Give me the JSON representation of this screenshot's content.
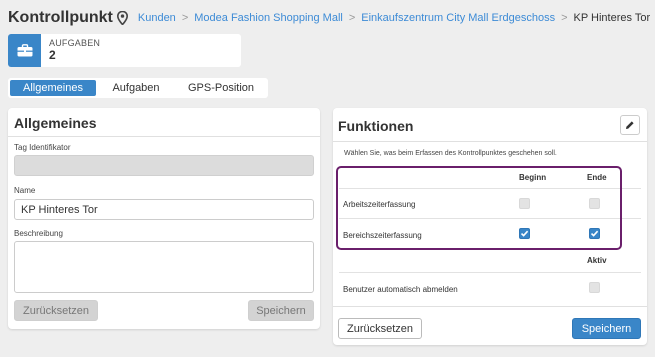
{
  "header": {
    "title": "Kontrollpunkt",
    "breadcrumb": [
      "Kunden",
      "Modea Fashion Shopping Mall",
      "Einkaufszentrum City Mall Erdgeschoss",
      "KP Hinteres Tor"
    ],
    "separator": ">"
  },
  "tasks": {
    "label": "AUFGABEN",
    "count": "2"
  },
  "tabs": [
    "Allgemeines",
    "Aufgaben",
    "GPS-Position"
  ],
  "general": {
    "title": "Allgemeines",
    "tag_label": "Tag Identifikator",
    "tag_value": "",
    "name_label": "Name",
    "name_value": "KP Hinteres Tor",
    "description_label": "Beschreibung",
    "description_value": "",
    "reset_label": "Zurücksetzen",
    "save_label": "Speichern"
  },
  "functions": {
    "title": "Funktionen",
    "description": "Wählen Sie, was beim Erfassen des Kontrollpunktes geschehen soll.",
    "col_begin": "Beginn",
    "col_end": "Ende",
    "col_active": "Aktiv",
    "rows": [
      {
        "label": "Arbeitszeiterfassung",
        "begin": false,
        "end": false,
        "disabled": true
      },
      {
        "label": "Bereichszeiterfassung",
        "begin": true,
        "end": true,
        "disabled": false
      }
    ],
    "auto_logout_label": "Benutzer automatisch abmelden",
    "auto_logout": false,
    "reset_label": "Zurücksetzen",
    "save_label": "Speichern"
  },
  "colors": {
    "accent": "#3a86c8",
    "highlight": "#6a1f6b",
    "link": "#3d8bd6"
  }
}
